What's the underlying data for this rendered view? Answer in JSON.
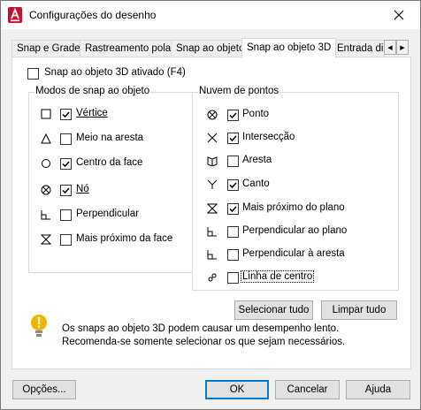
{
  "window": {
    "title": "Configurações do desenho",
    "app_icon": "autocad-icon",
    "close_icon": "close-icon"
  },
  "tabs": [
    {
      "label": "Snap e Grade",
      "active": false
    },
    {
      "label": "Rastreamento polar",
      "active": false
    },
    {
      "label": "Snap ao objeto",
      "active": false
    },
    {
      "label": "Snap ao objeto 3D",
      "active": true
    },
    {
      "label": "Entrada din",
      "active": false
    }
  ],
  "tab_scroll": {
    "left": "◀",
    "right": "▶"
  },
  "osnap3d_enabled": {
    "label": "Snap ao objeto 3D ativado (F4)",
    "checked": false
  },
  "modes_group": {
    "title": "Modos de snap ao objeto",
    "items": [
      {
        "symbol": "square-marker-icon",
        "label": "Vértice",
        "checked": true
      },
      {
        "symbol": "triangle-marker-icon",
        "label": "Meio na aresta",
        "checked": false
      },
      {
        "symbol": "circle-marker-icon",
        "label": "Centro da face",
        "checked": true
      },
      {
        "symbol": "node-marker-icon",
        "label": "Nó",
        "checked": true
      },
      {
        "symbol": "perpendicular-marker-icon",
        "label": "Perpendicular",
        "checked": false
      },
      {
        "symbol": "nearest-marker-icon",
        "label": "Mais próximo da face",
        "checked": false
      }
    ]
  },
  "cloud_group": {
    "title": "Nuvem de pontos",
    "items": [
      {
        "symbol": "node-marker-icon",
        "label": "Ponto",
        "checked": true
      },
      {
        "symbol": "intersection-marker-icon",
        "label": "Intersecção",
        "checked": true
      },
      {
        "symbol": "edge-marker-icon",
        "label": "Aresta",
        "checked": false
      },
      {
        "symbol": "corner-marker-icon",
        "label": "Canto",
        "checked": true
      },
      {
        "symbol": "nearest-marker-icon",
        "label": "Mais próximo do plano",
        "checked": true
      },
      {
        "symbol": "perpendicular-marker-icon",
        "label": "Perpendicular ao plano",
        "checked": false
      },
      {
        "symbol": "perpendicular-marker-icon",
        "label": "Perpendicular à aresta",
        "checked": false
      },
      {
        "symbol": "centerline-marker-icon",
        "label": "Linha de centro",
        "checked": false
      }
    ]
  },
  "select_all": "Selecionar tudo",
  "clear_all": "Limpar tudo",
  "warning": {
    "icon": "warning-bulb-icon",
    "line1": "Os snaps ao objeto 3D podem causar um desempenho lento.",
    "line2": "Recomenda-se somente selecionar os que sejam necessários."
  },
  "footer": {
    "options": "Opções...",
    "ok": "OK",
    "cancel": "Cancelar",
    "help": "Ajuda"
  }
}
